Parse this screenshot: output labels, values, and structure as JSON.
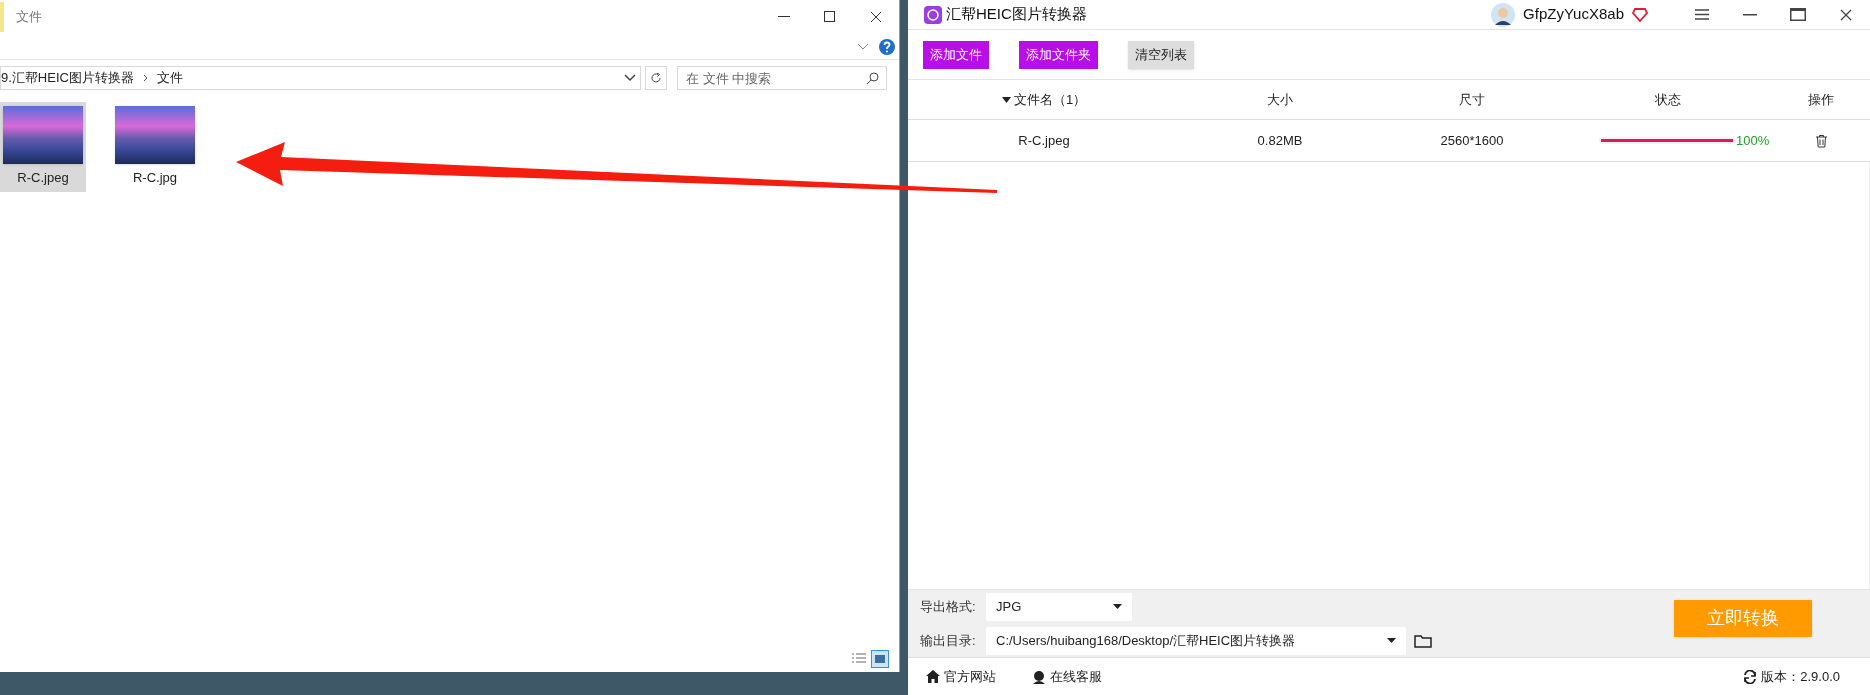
{
  "explorer": {
    "title": "文件",
    "path": [
      "9.汇帮HEIC图片转换器",
      "文件"
    ],
    "search": {
      "placeholder": "在 文件 中搜索"
    },
    "files": [
      {
        "name": "R-C.jpeg",
        "selected": true
      },
      {
        "name": "R-C.jpg",
        "selected": false
      }
    ]
  },
  "app": {
    "title": "汇帮HEIC图片转换器",
    "username": "GfpZyYucX8ab",
    "toolbar": [
      {
        "label": "添加文件",
        "kind": "primary"
      },
      {
        "label": "添加文件夹",
        "kind": "primary"
      },
      {
        "label": "清空列表",
        "kind": "secondary"
      }
    ],
    "columns": [
      "文件名（1）",
      "大小",
      "尺寸",
      "状态",
      "操作"
    ],
    "rows": [
      {
        "name": "R-C.jpeg",
        "size": "0.82MB",
        "dimensions": "2560*1600",
        "level": 1,
        "percent": "100%"
      }
    ],
    "export_format": {
      "label": "导出格式:",
      "value": "JPG"
    },
    "output_dir": {
      "label": "输出目录:",
      "value": "C:/Users/huibang168/Desktop/汇帮HEIC图片转换器"
    },
    "convert_button": "立即转换",
    "footer_links": [
      "官方网站",
      "在线客服"
    ],
    "version": "版本：2.9.0.0"
  }
}
